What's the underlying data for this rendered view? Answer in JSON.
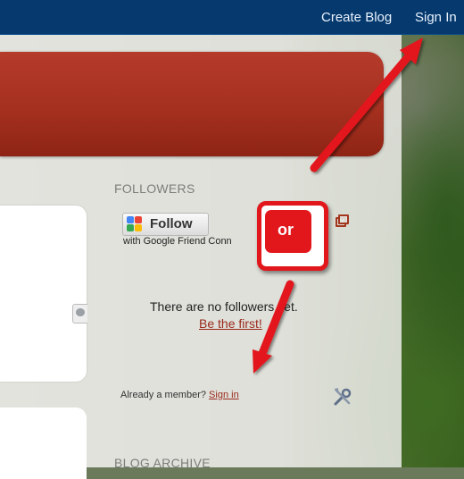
{
  "navbar": {
    "create_blog": "Create Blog",
    "sign_in": "Sign In"
  },
  "followers": {
    "title": "FOLLOWERS",
    "follow_button": "Follow",
    "gfc_text": "with Google Friend Conn",
    "empty_message": "There are no followers yet.",
    "be_first_link": "Be the first!",
    "already_member": "Already a member? ",
    "sign_in_link": "Sign in"
  },
  "archive": {
    "title": "BLOG ARCHIVE"
  },
  "annotation": {
    "label": "or"
  },
  "colors": {
    "navbar": "#063a6f",
    "banner": "#a5301f",
    "annotation_red": "#e2171b",
    "link_red": "#9a2a1c"
  },
  "icons": [
    "google-friend-connect-icon",
    "popout-icon",
    "tools-icon",
    "share-icon"
  ]
}
